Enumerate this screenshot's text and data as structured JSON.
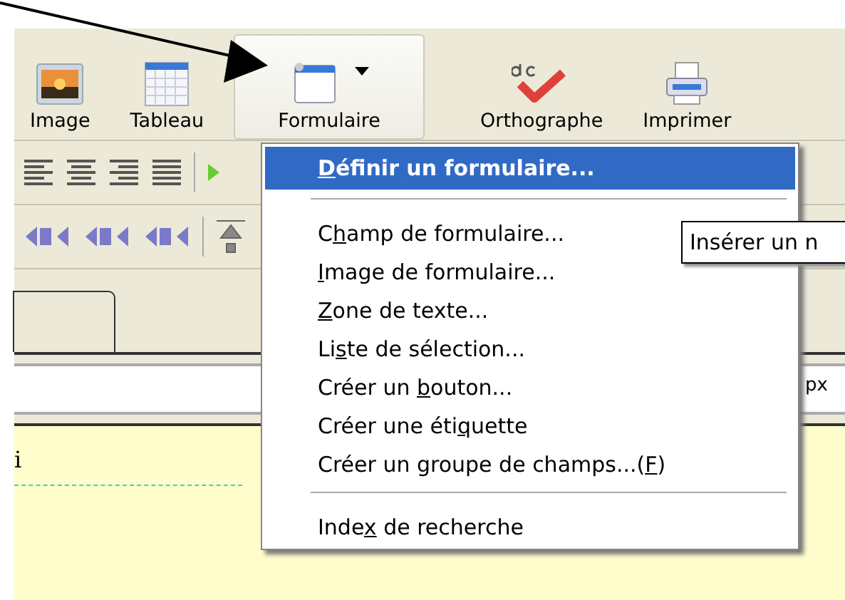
{
  "toolbar": {
    "buttons": [
      {
        "label": "Image",
        "kind": "image",
        "selected": false,
        "dropdown": false
      },
      {
        "label": "Tableau",
        "kind": "table",
        "selected": false,
        "dropdown": false
      },
      {
        "label": "Formulaire",
        "kind": "form",
        "selected": true,
        "dropdown": true
      },
      {
        "label": "Orthographe",
        "kind": "spell",
        "selected": false,
        "dropdown": false
      },
      {
        "label": "Imprimer",
        "kind": "print",
        "selected": false,
        "dropdown": false
      }
    ]
  },
  "size_field": {
    "value": "px"
  },
  "editor": {
    "text": "i"
  },
  "menu": {
    "groups": [
      [
        {
          "key": "D",
          "post": "éfinir un formulaire...",
          "selected": true
        }
      ],
      [
        {
          "pre": "C",
          "key": "h",
          "post": "amp de formulaire...",
          "selected": false
        },
        {
          "key": "I",
          "post": "mage de formulaire...",
          "selected": false
        },
        {
          "key": "Z",
          "post": "one de texte...",
          "selected": false
        },
        {
          "pre": "Li",
          "key": "s",
          "post": "te de sélection...",
          "selected": false
        },
        {
          "pre": "Créer un ",
          "key": "b",
          "post": "outon...",
          "selected": false
        },
        {
          "pre": "Créer une éti",
          "key": "q",
          "post": "uette",
          "selected": false
        },
        {
          "pre": "Créer un groupe de champs...(",
          "key": "F",
          "post": ")",
          "selected": false
        }
      ],
      [
        {
          "pre": "Inde",
          "key": "x",
          "post": " de recherche",
          "selected": false
        }
      ]
    ]
  },
  "tooltip": {
    "text": "Insérer un n"
  }
}
